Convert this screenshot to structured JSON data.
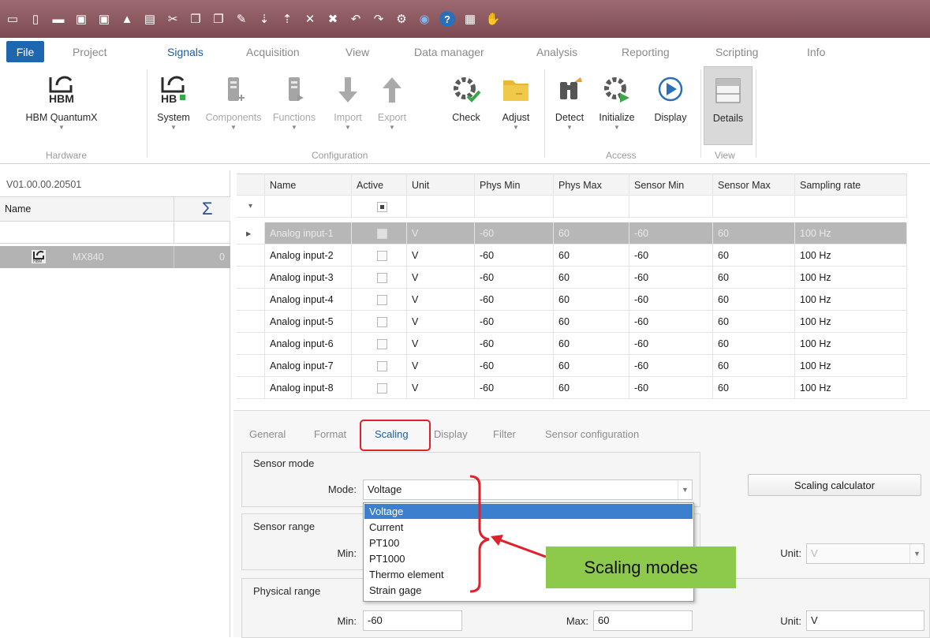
{
  "quick_access": {
    "icons": [
      "app-icon",
      "new-file-icon",
      "open-folder-icon",
      "save-icon",
      "save-as-icon",
      "auto-icon",
      "print-icon",
      "cut-icon",
      "copy-icon",
      "paste-icon",
      "edit-icon",
      "import-icon",
      "export-icon",
      "delete-icon",
      "delete-all-icon",
      "undo-icon",
      "redo-icon",
      "settings-icon",
      "config-icon",
      "help-icon",
      "image-icon",
      "hand-icon"
    ]
  },
  "menu": {
    "file": "File",
    "tabs": [
      "Project",
      "Signals",
      "Acquisition",
      "View",
      "Data manager",
      "Analysis",
      "Reporting",
      "Scripting",
      "Info"
    ],
    "active": "Signals"
  },
  "ribbon": {
    "hardware": {
      "button": "HBM QuantumX",
      "group": "Hardware"
    },
    "configuration": {
      "buttons": [
        "System",
        "Components",
        "Functions",
        "Import",
        "Export",
        "Check",
        "Adjust"
      ],
      "group": "Configuration"
    },
    "access": {
      "buttons": [
        "Detect",
        "Initialize",
        "Display"
      ],
      "group": "Access"
    },
    "view": {
      "button": "Details",
      "group": "View"
    },
    "logo_text": "HBM",
    "system_logo_text": "HB"
  },
  "left_panel": {
    "version": "V01.00.00.20501",
    "column_name": "Name",
    "sum_symbol": "Σ",
    "device": {
      "name": "MX840",
      "count": "0"
    }
  },
  "grid": {
    "columns": [
      "Name",
      "Active",
      "Unit",
      "Phys Min",
      "Phys Max",
      "Sensor Min",
      "Sensor Max",
      "Sampling rate"
    ],
    "rows": [
      {
        "name": "Analog input-1",
        "unit": "V",
        "phys_min": "-60",
        "phys_max": "60",
        "sensor_min": "-60",
        "sensor_max": "60",
        "rate": "100 Hz"
      },
      {
        "name": "Analog input-2",
        "unit": "V",
        "phys_min": "-60",
        "phys_max": "60",
        "sensor_min": "-60",
        "sensor_max": "60",
        "rate": "100 Hz"
      },
      {
        "name": "Analog input-3",
        "unit": "V",
        "phys_min": "-60",
        "phys_max": "60",
        "sensor_min": "-60",
        "sensor_max": "60",
        "rate": "100 Hz"
      },
      {
        "name": "Analog input-4",
        "unit": "V",
        "phys_min": "-60",
        "phys_max": "60",
        "sensor_min": "-60",
        "sensor_max": "60",
        "rate": "100 Hz"
      },
      {
        "name": "Analog input-5",
        "unit": "V",
        "phys_min": "-60",
        "phys_max": "60",
        "sensor_min": "-60",
        "sensor_max": "60",
        "rate": "100 Hz"
      },
      {
        "name": "Analog input-6",
        "unit": "V",
        "phys_min": "-60",
        "phys_max": "60",
        "sensor_min": "-60",
        "sensor_max": "60",
        "rate": "100 Hz"
      },
      {
        "name": "Analog input-7",
        "unit": "V",
        "phys_min": "-60",
        "phys_max": "60",
        "sensor_min": "-60",
        "sensor_max": "60",
        "rate": "100 Hz"
      },
      {
        "name": "Analog input-8",
        "unit": "V",
        "phys_min": "-60",
        "phys_max": "60",
        "sensor_min": "-60",
        "sensor_max": "60",
        "rate": "100 Hz"
      }
    ]
  },
  "detail": {
    "tabs": [
      "General",
      "Format",
      "Scaling",
      "Display",
      "Filter",
      "Sensor configuration"
    ],
    "active_tab": "Scaling",
    "sensor_mode": {
      "title": "Sensor mode",
      "mode_label": "Mode:",
      "mode_value": "Voltage"
    },
    "scaling_calculator": "Scaling calculator",
    "sensor_range": {
      "title": "Sensor range",
      "min_label": "Min:",
      "unit_label": "Unit:",
      "unit_value": "V"
    },
    "physical_range": {
      "title": "Physical range",
      "min_label": "Min:",
      "min_value": "-60",
      "max_label": "Max:",
      "max_value": "60",
      "unit_label": "Unit:",
      "unit_value": "V"
    },
    "mode_options": [
      "Voltage",
      "Current",
      "PT100",
      "PT1000",
      "Thermo element",
      "Strain gage"
    ],
    "selected_option": "Voltage"
  },
  "annotation": {
    "callout": "Scaling modes"
  },
  "colors": {
    "titlebar": "#8a5a61",
    "file_tab": "#1c67b0",
    "accent": "#1c5d99",
    "selection": "#3d7fcf",
    "highlight": "#e0202a",
    "callout": "#8dc94b"
  }
}
